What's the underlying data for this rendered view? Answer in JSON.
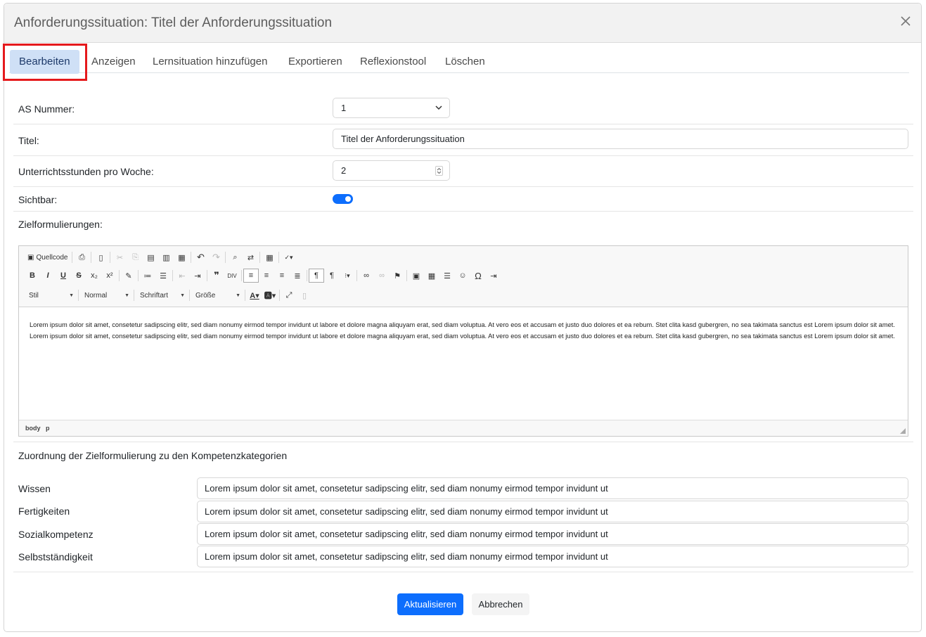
{
  "modal": {
    "title": "Anforderungssituation: Titel der Anforderungssituation",
    "close_icon": "close-icon"
  },
  "tabs": [
    {
      "label": "Bearbeiten",
      "active": true
    },
    {
      "label": "Anzeigen"
    },
    {
      "label": "Lernsituation hinzufügen"
    },
    {
      "label": "Exportieren"
    },
    {
      "label": "Reflexionstool"
    },
    {
      "label": "Löschen"
    }
  ],
  "form": {
    "as_nummer": {
      "label": "AS Nummer:",
      "value": "1"
    },
    "titel": {
      "label": "Titel:",
      "value": "Titel der Anforderungssituation"
    },
    "stunden": {
      "label": "Unterrichtsstunden pro Woche:",
      "value": "2"
    },
    "sichtbar": {
      "label": "Sichtbar:",
      "checked": true
    },
    "zielformulierungen": {
      "label": "Zielformulierungen:"
    }
  },
  "editor": {
    "source_label": "Quellcode",
    "style_combo": "Stil",
    "format_combo": "Normal",
    "font_combo": "Schriftart",
    "size_combo": "Größe",
    "content": "Lorem ipsum dolor sit amet, consetetur sadipscing elitr, sed diam nonumy eirmod tempor invidunt ut labore et dolore magna aliquyam erat, sed diam voluptua. At vero eos et accusam et justo duo dolores et ea rebum. Stet clita kasd gubergren, no sea takimata sanctus est Lorem ipsum dolor sit amet. Lorem ipsum dolor sit amet, consetetur sadipscing elitr, sed diam nonumy eirmod tempor invidunt ut labore et dolore magna aliquyam erat, sed diam voluptua. At vero eos et accusam et justo duo dolores et ea rebum. Stet clita kasd gubergren, no sea takimata sanctus est Lorem ipsum dolor sit amet.",
    "path": [
      "body",
      "p"
    ]
  },
  "kompetenzen": {
    "title": "Zuordnung der Zielformulierung zu den Kompetenzkategorien",
    "items": [
      {
        "label": "Wissen",
        "value": "Lorem ipsum dolor sit amet, consetetur sadipscing elitr, sed diam nonumy eirmod tempor invidunt ut"
      },
      {
        "label": "Fertigkeiten",
        "value": "Lorem ipsum dolor sit amet, consetetur sadipscing elitr, sed diam nonumy eirmod tempor invidunt ut"
      },
      {
        "label": "Sozialkompetenz",
        "value": "Lorem ipsum dolor sit amet, consetetur sadipscing elitr, sed diam nonumy eirmod tempor invidunt ut"
      },
      {
        "label": "Selbstständigkeit",
        "value": "Lorem ipsum dolor sit amet, consetetur sadipscing elitr, sed diam nonumy eirmod tempor invidunt ut"
      }
    ]
  },
  "footer": {
    "submit_label": "Aktualisieren",
    "cancel_label": "Abbrechen"
  },
  "colors": {
    "primary": "#0d6efd",
    "active_tab_bg": "#cfe0f6",
    "highlight": "#e5191c"
  }
}
